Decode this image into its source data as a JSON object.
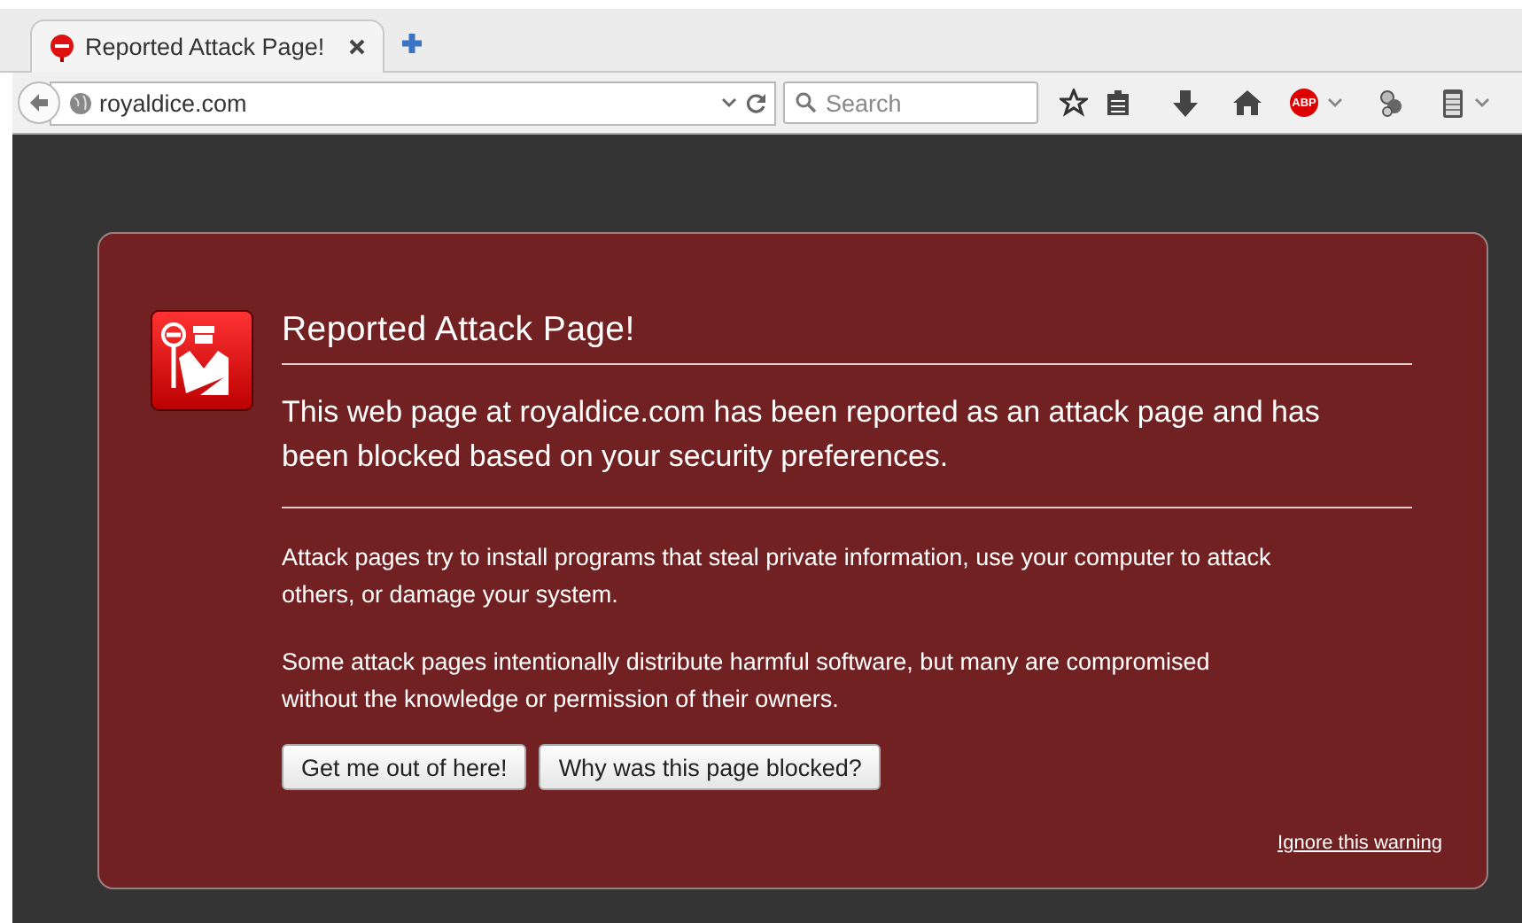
{
  "tabs": [
    {
      "title": "Reported Attack Page!",
      "selected": true
    }
  ],
  "address_bar": {
    "value": "royaldice.com"
  },
  "search": {
    "placeholder": "Search"
  },
  "adblock_badge": "ABP",
  "error_page": {
    "title": "Reported Attack Page!",
    "intro": "This web page at royaldice.com has been reported as an attack page and has been blocked based on your security preferences.",
    "paragraphs": [
      "Attack pages try to install programs that steal private information, use your computer to attack others, or damage your system.",
      "Some attack pages intentionally distribute harmful software, but many are compromised without the knowledge or permission of their owners."
    ],
    "buttons": [
      "Get me out of here!",
      "Why was this page blocked?"
    ],
    "link": "Ignore this warning"
  }
}
